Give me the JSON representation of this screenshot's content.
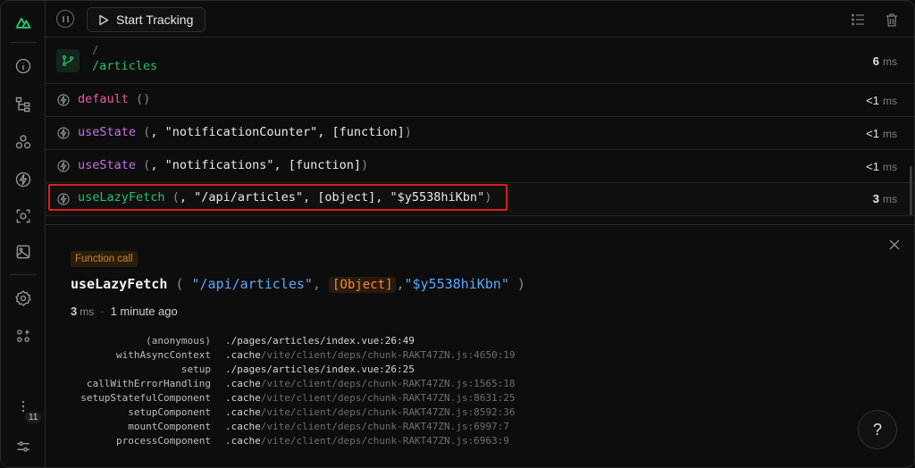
{
  "toolbar": {
    "track_label": "Start Tracking"
  },
  "sidebar": {
    "badge_count": "11"
  },
  "route_row": {
    "path_prefix": "/",
    "path": "/articles",
    "duration": "6",
    "unit": "ms"
  },
  "rows": [
    {
      "fn": "default",
      "args_open": "(",
      "args": "",
      "args_close": ")",
      "duration": "<1",
      "unit": "ms"
    },
    {
      "fn": "useState",
      "args_open": "(",
      "args": ", \"notificationCounter\", [function]",
      "args_close": ")",
      "duration": "<1",
      "unit": "ms"
    },
    {
      "fn": "useState",
      "args_open": "(",
      "args": ", \"notifications\", [function]",
      "args_close": ")",
      "duration": "<1",
      "unit": "ms"
    },
    {
      "fn": "useLazyFetch",
      "args_open": "(",
      "args": ", \"/api/articles\", [object], \"$y5538hiKbn\"",
      "args_close": ")",
      "duration": "3",
      "unit": "ms"
    }
  ],
  "detail": {
    "badge": "Function call",
    "fname": "useLazyFetch",
    "open": "(",
    "arg1": "\"/api/articles\"",
    "comma1": ",",
    "arg2": "[Object]",
    "comma2": ",",
    "arg3": "\"$y5538hiKbn\"",
    "close": ")",
    "duration": "3",
    "unit": "ms",
    "dot": "·",
    "ago": "1 minute ago",
    "help": "?",
    "stack": [
      {
        "fn": "(anonymous)",
        "lead": "./pages/articles/index.vue:26:49",
        "rest": ""
      },
      {
        "fn": "withAsyncContext",
        "lead": ".cache",
        "rest": "/vite/client/deps/chunk-RAKT47ZN.js:4650:19"
      },
      {
        "fn": "setup",
        "lead": "./pages/articles/index.vue:26:25",
        "rest": ""
      },
      {
        "fn": "callWithErrorHandling",
        "lead": ".cache",
        "rest": "/vite/client/deps/chunk-RAKT47ZN.js:1565:18"
      },
      {
        "fn": "setupStatefulComponent",
        "lead": ".cache",
        "rest": "/vite/client/deps/chunk-RAKT47ZN.js:8631:25"
      },
      {
        "fn": "setupComponent",
        "lead": ".cache",
        "rest": "/vite/client/deps/chunk-RAKT47ZN.js:8592:36"
      },
      {
        "fn": "mountComponent",
        "lead": ".cache",
        "rest": "/vite/client/deps/chunk-RAKT47ZN.js:6997:7"
      },
      {
        "fn": "processComponent",
        "lead": ".cache",
        "rest": "/vite/client/deps/chunk-RAKT47ZN.js:6963:9"
      }
    ]
  },
  "colors": {
    "accent": "#21c26b",
    "highlight": "#d92020",
    "pink": "#e0609c",
    "purple": "#c472e8",
    "link_blue": "#5aa8ff",
    "orange": "#f08a3a"
  }
}
